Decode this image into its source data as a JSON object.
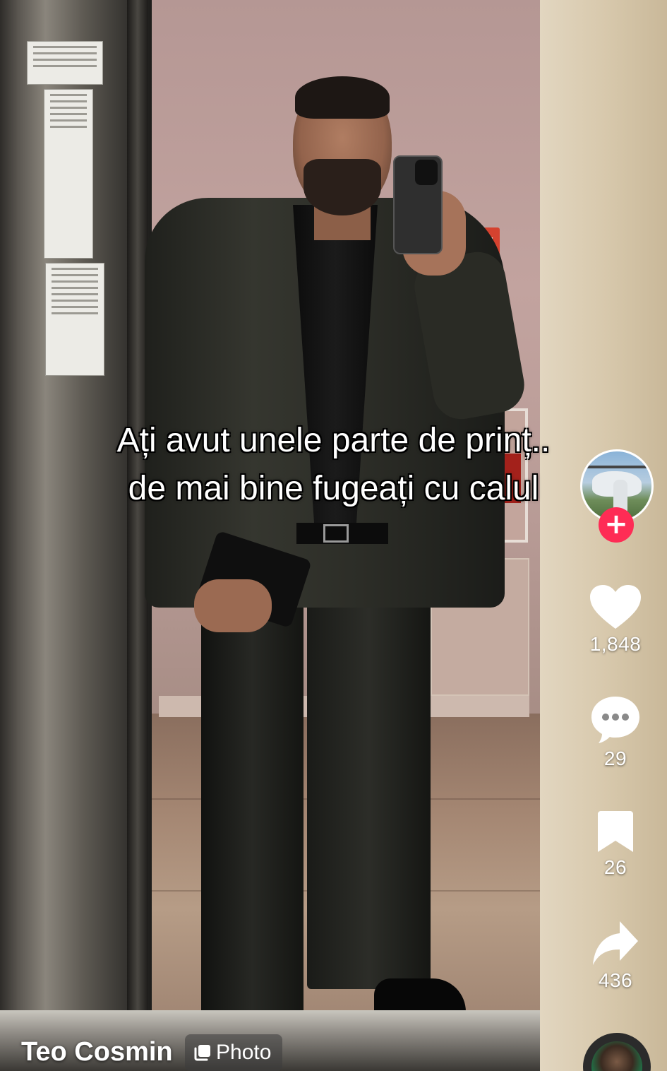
{
  "caption": {
    "line1": "Ați avut unele parte de prinț..",
    "line2": "de mai bine fugeați cu calul"
  },
  "creator": {
    "username": "Teo Cosmin",
    "follow_symbol": "+"
  },
  "post": {
    "type_label": "Photo"
  },
  "actions": {
    "likes": "1,848",
    "comments": "29",
    "saves": "26",
    "shares": "436"
  },
  "colors": {
    "follow_accent": "#fe2c55",
    "icon": "#ffffff"
  },
  "icons": {
    "like": "heart-icon",
    "comment": "comment-bubble-icon",
    "save": "bookmark-icon",
    "share": "share-arrow-icon",
    "photo": "photo-icon"
  }
}
